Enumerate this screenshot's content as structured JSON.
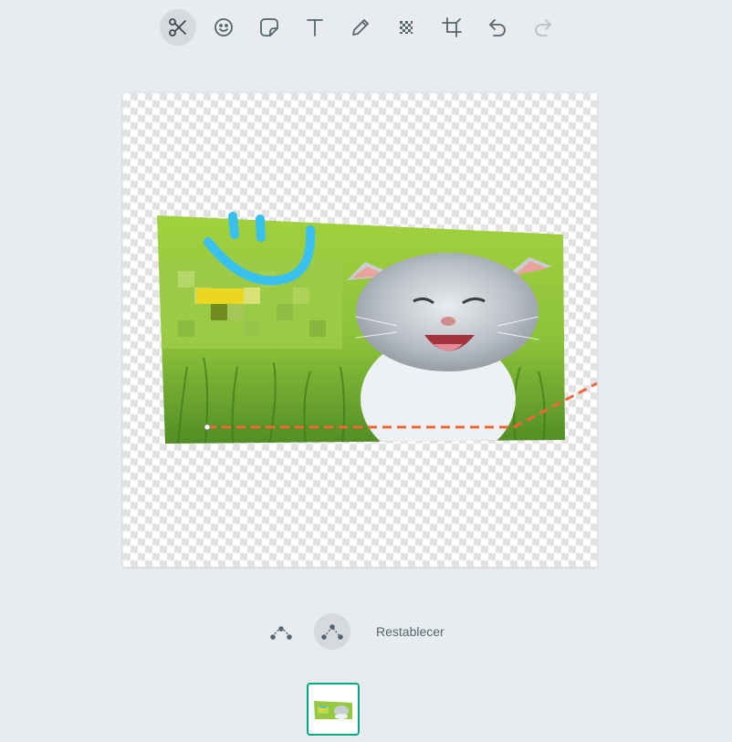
{
  "toolbar": {
    "tools": [
      {
        "name": "scissors-icon",
        "active": true
      },
      {
        "name": "emoji-icon",
        "active": false
      },
      {
        "name": "sticker-icon",
        "active": false
      },
      {
        "name": "text-icon",
        "active": false
      },
      {
        "name": "pencil-icon",
        "active": false
      },
      {
        "name": "pixelate-icon",
        "active": false
      },
      {
        "name": "crop-icon",
        "active": false
      },
      {
        "name": "undo-icon",
        "active": false
      },
      {
        "name": "redo-icon",
        "active": false,
        "disabled": true
      }
    ]
  },
  "cutout": {
    "controls": [
      {
        "name": "curve-smooth-icon",
        "active": false
      },
      {
        "name": "curve-sharp-icon",
        "active": true
      }
    ],
    "reset_label": "Restablecer"
  },
  "colors": {
    "accent": "#00a884",
    "icon": "#54656f",
    "drawing": "#38c1ee",
    "cut_path": "#f0683a"
  }
}
